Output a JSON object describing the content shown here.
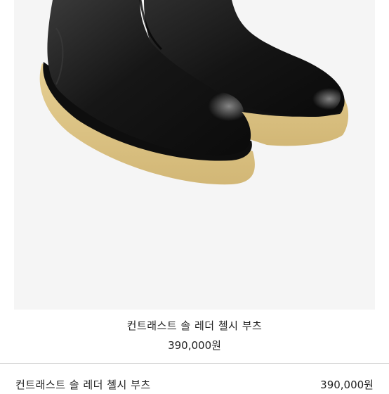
{
  "product": {
    "name": "컨트래스트 솔 레더 첼시 부츠",
    "price": "390,000원"
  },
  "summary": {
    "name": "컨트래스트 솔 레더 첼시 부츠",
    "price": "390,000원"
  }
}
